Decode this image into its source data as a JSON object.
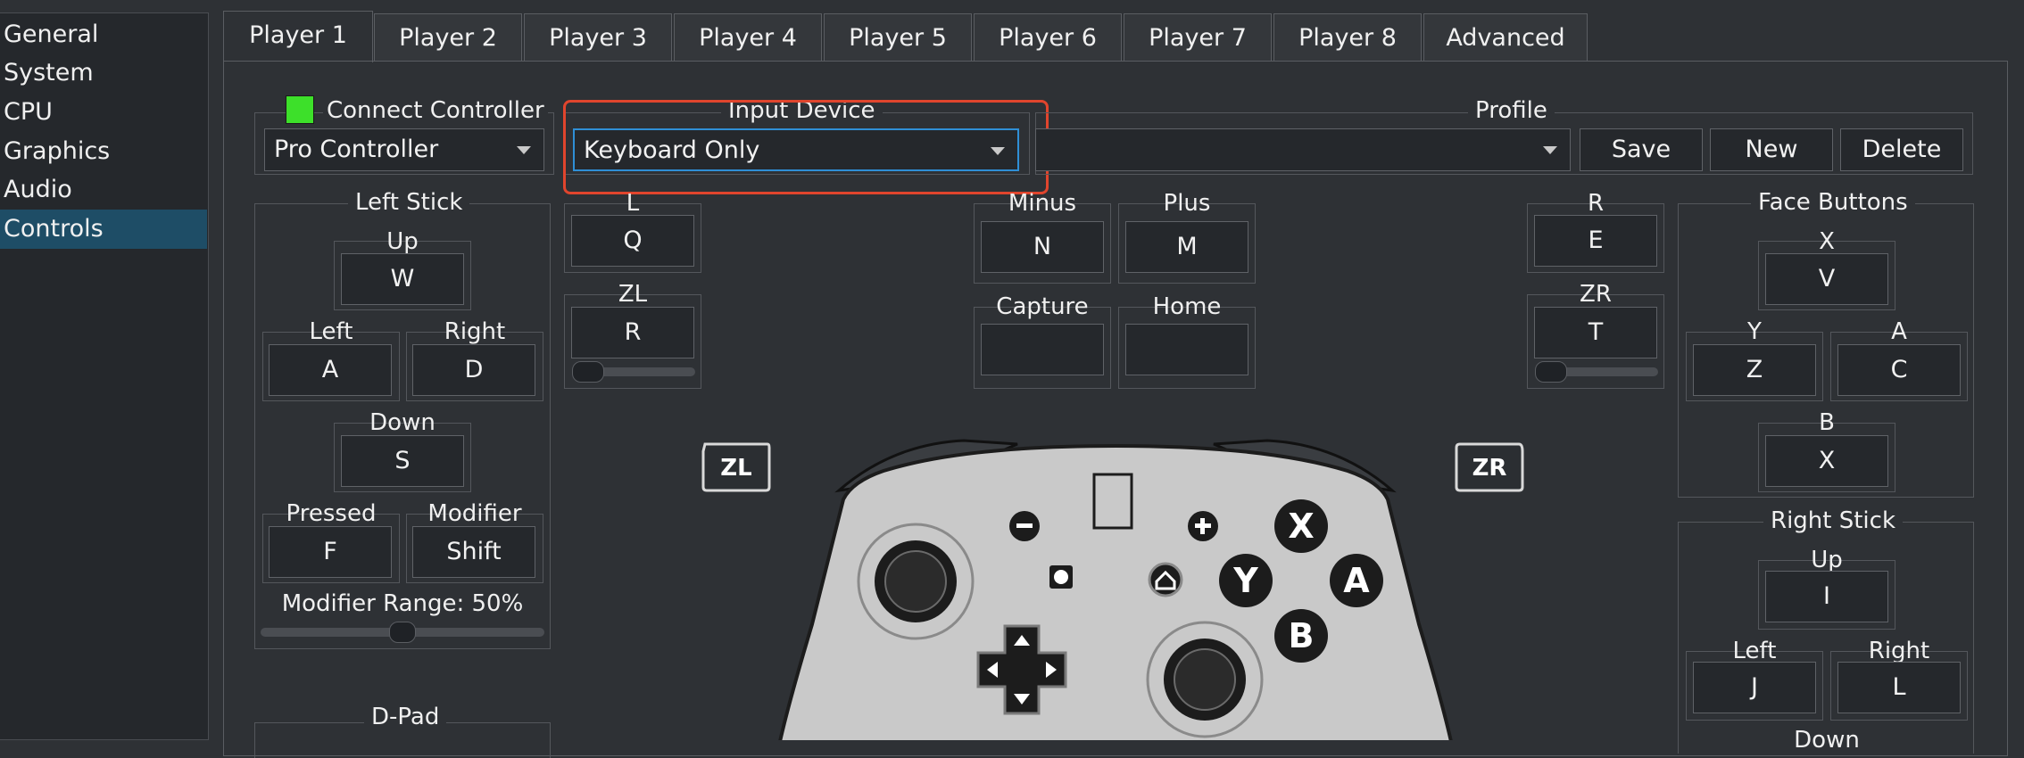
{
  "sidebar": {
    "items": [
      "General",
      "System",
      "CPU",
      "Graphics",
      "Audio",
      "Controls"
    ]
  },
  "tabs": [
    "Player 1",
    "Player 2",
    "Player 3",
    "Player 4",
    "Player 5",
    "Player 6",
    "Player 7",
    "Player 8",
    "Advanced"
  ],
  "connect": {
    "label": "Connect Controller",
    "controller_type": "Pro Controller",
    "indicator_color": "#3de02a"
  },
  "input_device": {
    "title": "Input Device",
    "value": "Keyboard Only",
    "highlight_color": "#e0452d"
  },
  "profile": {
    "title": "Profile",
    "value": "",
    "save": "Save",
    "new": "New",
    "delete": "Delete"
  },
  "left_stick": {
    "title": "Left Stick",
    "up": {
      "label": "Up",
      "key": "W"
    },
    "left": {
      "label": "Left",
      "key": "A"
    },
    "right": {
      "label": "Right",
      "key": "D"
    },
    "down": {
      "label": "Down",
      "key": "S"
    },
    "pressed": {
      "label": "Pressed",
      "key": "F"
    },
    "modifier": {
      "label": "Modifier",
      "key": "Shift"
    },
    "modifier_range": "Modifier Range: 50%",
    "modifier_range_value": 0.5
  },
  "dpad": {
    "title": "D-Pad"
  },
  "l": {
    "label": "L",
    "key": "Q"
  },
  "zl": {
    "label": "ZL",
    "key": "R",
    "slider_value": 0
  },
  "minus": {
    "label": "Minus",
    "key": "N"
  },
  "plus": {
    "label": "Plus",
    "key": "M"
  },
  "capture": {
    "label": "Capture",
    "key": ""
  },
  "home": {
    "label": "Home",
    "key": ""
  },
  "r": {
    "label": "R",
    "key": "E"
  },
  "zr": {
    "label": "ZR",
    "key": "T",
    "slider_value": 0
  },
  "face_buttons": {
    "title": "Face Buttons",
    "x": {
      "label": "X",
      "key": "V"
    },
    "y": {
      "label": "Y",
      "key": "Z"
    },
    "a": {
      "label": "A",
      "key": "C"
    },
    "b": {
      "label": "B",
      "key": "X"
    }
  },
  "right_stick": {
    "title": "Right Stick",
    "up": {
      "label": "Up",
      "key": "I"
    },
    "left": {
      "label": "Left",
      "key": "J"
    },
    "right": {
      "label": "Right",
      "key": "L"
    },
    "down": {
      "label": "Down"
    }
  },
  "controller_image": {
    "zl_badge": "ZL",
    "zr_badge": "ZR",
    "x": "X",
    "y": "Y",
    "a": "A",
    "b": "B"
  }
}
